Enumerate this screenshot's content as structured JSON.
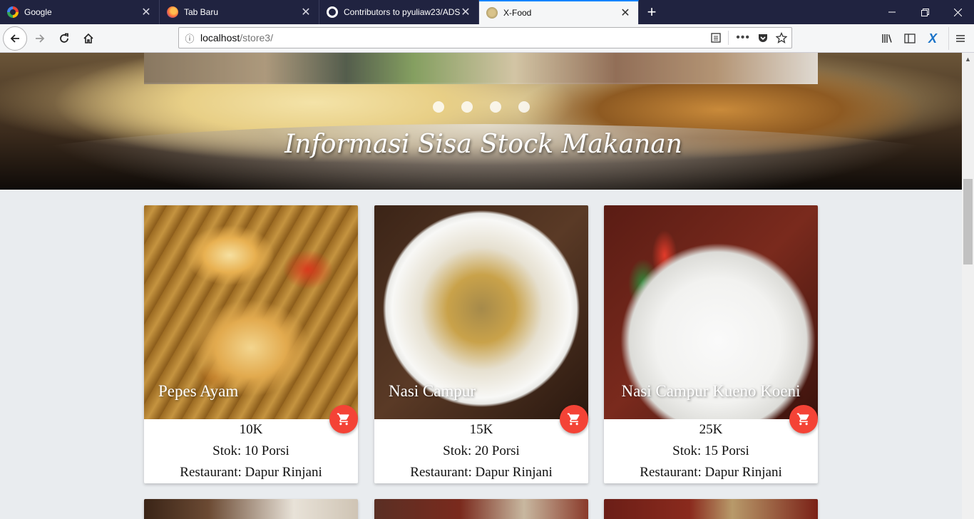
{
  "browser": {
    "tabs": [
      {
        "label": "Google",
        "icon": "google-icon"
      },
      {
        "label": "Tab Baru",
        "icon": "firefox-icon"
      },
      {
        "label": "Contributors to pyuliaw23/ADS",
        "icon": "github-icon"
      },
      {
        "label": "X-Food",
        "icon": "xfood-icon",
        "active": true
      }
    ],
    "url_host": "localhost",
    "url_path": "/store3/"
  },
  "hero": {
    "caption": "Informasi Sisa Stock Makanan",
    "indicator_count": 4
  },
  "products": [
    {
      "name": "Pepes Ayam",
      "price": "10K",
      "stock": "Stok: 10 Porsi",
      "restaurant": "Restaurant: Dapur Rinjani"
    },
    {
      "name": "Nasi Campur",
      "price": "15K",
      "stock": "Stok: 20 Porsi",
      "restaurant": "Restaurant: Dapur Rinjani"
    },
    {
      "name": "Nasi Campur Kueno Koeni",
      "price": "25K",
      "stock": "Stok: 15 Porsi",
      "restaurant": "Restaurant: Dapur Rinjani"
    }
  ],
  "colors": {
    "accent_fab": "#f44336",
    "page_bg": "#e9ecef",
    "tabbar_bg": "#202340"
  }
}
